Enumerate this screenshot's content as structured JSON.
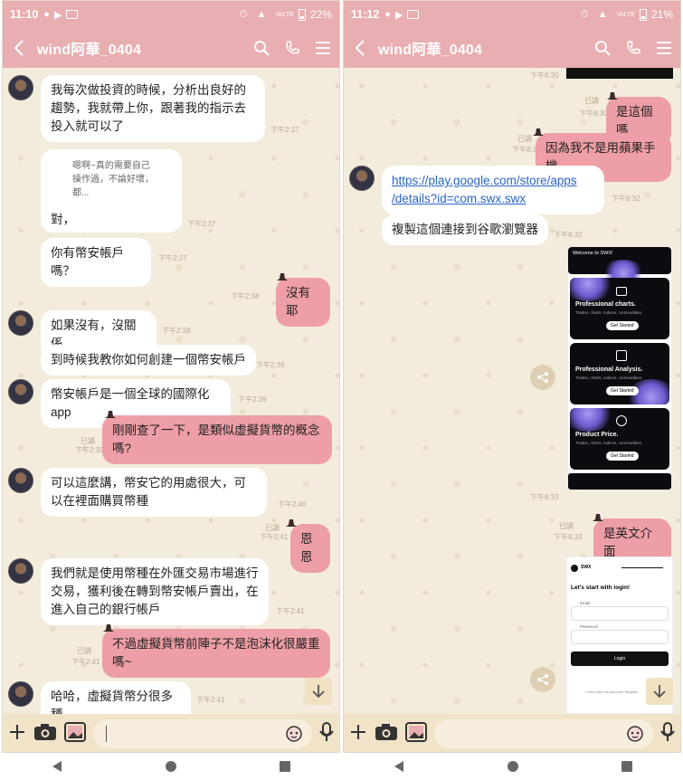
{
  "left": {
    "status": {
      "time": "11:10",
      "battery": "22%",
      "net": "VoLTE"
    },
    "header": {
      "title": "wind阿華_0404"
    },
    "messages": {
      "m1": {
        "text": "我每次做投資的時候，分析出良好的趨勢，我就帶上你，跟著我的指示去投入就可以了",
        "time": "下午2:37"
      },
      "m2": {
        "quoted": "嗯啊~真的需要自己操作過，不論好壞，都...",
        "text": "對，",
        "time": "下午2:37"
      },
      "m3": {
        "text": "你有幣安帳戶嗎？",
        "time": "下午2:37"
      },
      "m4": {
        "text": "沒有耶",
        "time": "下午2:38"
      },
      "m5": {
        "text": "如果沒有，沒關係",
        "time": "下午2:38"
      },
      "m6": {
        "text": "到時候我教你如何創建一個幣安帳戶",
        "time": "下午2:39"
      },
      "m7": {
        "text": "幣安帳戶是一個全球的國際化app",
        "time": "下午2:39"
      },
      "m8": {
        "text": "剛剛查了一下，是類似虛擬貨幣的概念嗎?",
        "read": "已讀",
        "time": "下午2:39"
      },
      "m9": {
        "text": "可以這麼講，幣安它的用處很大，可以在裡面購買幣種",
        "time": "下午2:40"
      },
      "m10": {
        "text": "恩恩",
        "read": "已讀",
        "time": "下午2:41"
      },
      "m11": {
        "text": "我們就是使用幣種在外匯交易市場進行交易，獲利後在轉到幣安帳戶賣出，在進入自己的銀行帳戶",
        "time": "下午2:41"
      },
      "m12": {
        "text": "不過虛擬貨幣前陣子不是泡沫化很嚴重嗎~",
        "read": "已讀",
        "time": "下午2:41"
      },
      "m13": {
        "text": "哈哈，虛擬貨幣分很多種",
        "time": "下午2:41"
      }
    }
  },
  "right": {
    "status": {
      "time": "11:12",
      "battery": "21%",
      "net": "VoLTE"
    },
    "header": {
      "title": "wind阿華_0404"
    },
    "messages": {
      "r0": {
        "time": "下午8:30"
      },
      "r1": {
        "text": "是這個嗎",
        "read": "已讀",
        "time": "下午8:30"
      },
      "r2": {
        "text": "因為我不是用蘋果手機",
        "read": "已讀",
        "time": "下午8:30"
      },
      "r3": {
        "link1": "https://play.google.com/store/apps",
        "link2": "/details?id=com.swx.swx",
        "time": "下午8:32"
      },
      "r4": {
        "text": "複製這個連接到谷歌瀏覽器",
        "time": "下午8:32"
      },
      "r5": {
        "time": "下午8:33"
      },
      "r6": {
        "text": "是英文介面",
        "read": "已讀",
        "time": "下午8:33"
      }
    },
    "app_shot1": {
      "welcome": "Welcome to SWX!",
      "card1_title": "Professional charts.",
      "card2_title": "Professional Analysis.",
      "card3_title": "Product Price.",
      "card_sub": "Trades, charts, indices, commodities.",
      "button": "Get Started"
    },
    "app_shot2": {
      "brand": "SWX",
      "heading": "Let's start with login!",
      "email_label": "Email",
      "password_label": "Password",
      "login_button": "Login",
      "footer": "I don't have an account! Register"
    }
  },
  "colors": {
    "header": "#e9aeb1",
    "out_bubble": "#ee9ea6",
    "in_bubble": "#ffffff",
    "chat_bg": "#f3ecdc"
  },
  "icons": [
    "back-icon",
    "search-icon",
    "phone-icon",
    "menu-icon",
    "plus-icon",
    "camera-icon",
    "image-icon",
    "sticker-icon",
    "mic-icon",
    "share-icon",
    "arrow-down-icon"
  ]
}
